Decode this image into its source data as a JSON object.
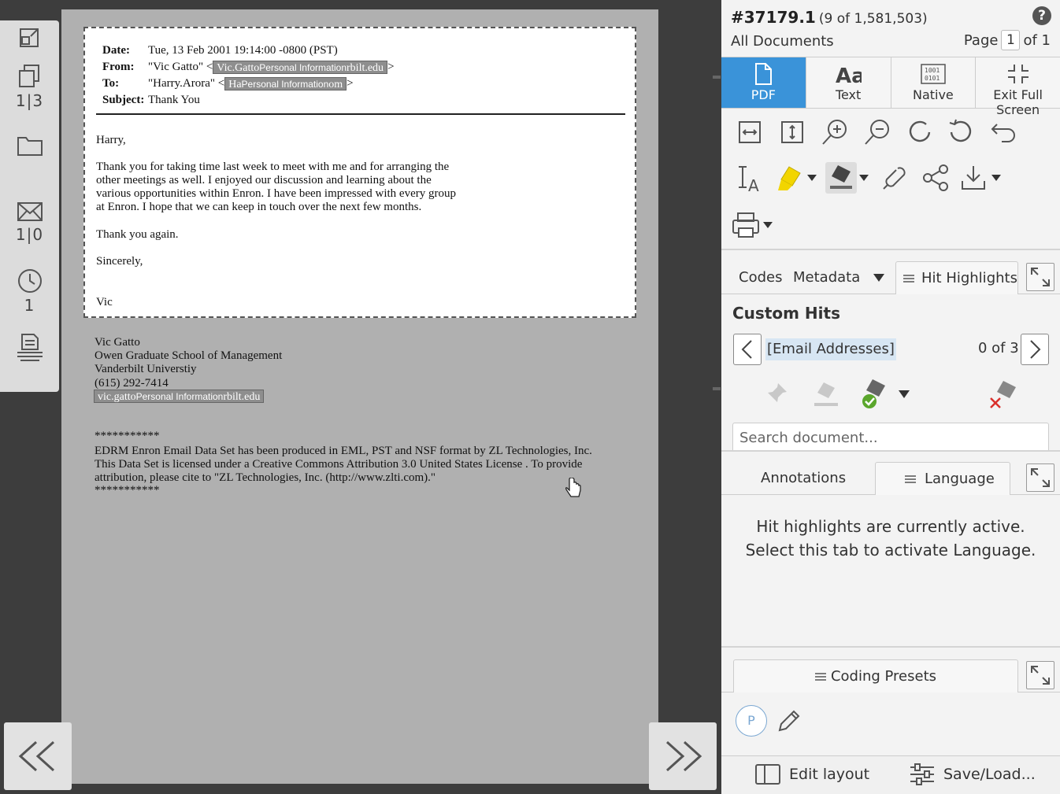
{
  "rail": {
    "attachments_count": "1|3",
    "email_thread_count": "1|0",
    "history_count": "1"
  },
  "email": {
    "date_label": "Date:",
    "date_value": "Tue, 13 Feb 2001 19:14:00 -0800 (PST)",
    "from_label": "From:",
    "from_name": "\"Vic Gatto\" <",
    "from_email_start": "Vic.Gatto",
    "from_email_end": "rbilt.edu",
    "to_label": "To:",
    "to_name": "\"Harry.Arora\" <",
    "to_email_start": "Ha",
    "to_email_end": "om",
    "subject_label": "Subject:",
    "subject_value": "Thank You",
    "redaction_label": "Personal Information",
    "close_bracket": ">",
    "greeting": "Harry,",
    "paragraph1": "Thank you for taking time last week to meet with me and for arranging the\nother meetings as well. I enjoyed our discussion and learning about the\nvarious opportunities within Enron. I have been impressed with every group\nat Enron. I hope that we can keep in touch over the next few months.",
    "thanks": "Thank you again.",
    "closing": "Sincerely,",
    "signature": "Vic"
  },
  "below": {
    "sig_block": "Vic Gatto\nOwen Graduate School of Management\nVanderbilt Universtiy\n(615) 292-7414",
    "sig_email_start": "vic.gatto",
    "sig_email_end": "rbilt.edu",
    "stars1": "***********",
    "notice": "EDRM Enron Email Data Set has been produced in EML, PST and NSF format by ZL Technologies, Inc.\nThis Data Set is licensed under a Creative Commons Attribution 3.0 United States License . To provide\nattribution, please cite to \"ZL Technologies, Inc. (http://www.zlti.com).\"",
    "stars2": "***********"
  },
  "panel": {
    "doc_number": "#37179.1",
    "doc_position": "(9 of 1,581,503)",
    "help": "?",
    "collection": "All Documents",
    "page_label": "Page",
    "page_value": "1",
    "page_of": "of 1"
  },
  "view_tabs": {
    "pdf": "PDF",
    "text": "Text",
    "native": "Native",
    "exit_full_screen": "Exit Full Screen"
  },
  "side_tabs": {
    "codes": "Codes",
    "metadata": "Metadata",
    "hit_highlights": "Hit Highlights"
  },
  "hits": {
    "title": "Custom Hits",
    "term": "[Email Addresses]",
    "count": "0 of 3",
    "search_placeholder": "Search document..."
  },
  "lower_tabs": {
    "annotations": "Annotations",
    "language": "Language",
    "message": "Hit highlights are currently active.\nSelect this tab to activate Language."
  },
  "presets": {
    "title": "Coding Presets",
    "avatar": "P"
  },
  "bottom": {
    "edit_layout": "Edit layout",
    "save_load": "Save/Load..."
  },
  "colors": {
    "accent": "#3a93d9",
    "highlighter": "#f2d500",
    "check_green": "#5aa62c",
    "reject_red": "#d9302c"
  }
}
